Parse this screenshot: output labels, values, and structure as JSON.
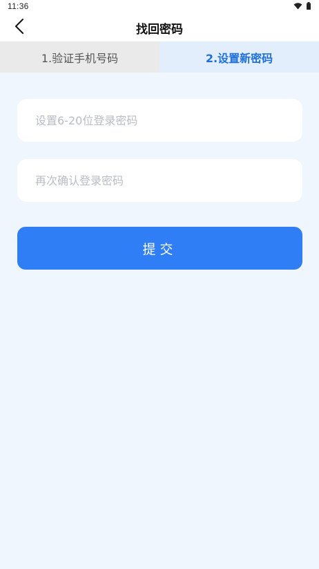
{
  "status_bar": {
    "time": "11:36",
    "icons": [
      "wifi-icon",
      "battery-icon"
    ]
  },
  "header": {
    "title": "找回密码",
    "back_icon": "chevron-left-icon"
  },
  "steps": [
    {
      "label": "1.验证手机号码",
      "active": false
    },
    {
      "label": "2.设置新密码",
      "active": true
    }
  ],
  "form": {
    "password_placeholder": "设置6-20位登录密码",
    "confirm_placeholder": "再次确认登录密码",
    "password_value": "",
    "confirm_value": ""
  },
  "submit": {
    "label": "提交"
  },
  "colors": {
    "page_bg": "#f0f6fd",
    "accent": "#2f7ef6",
    "active_step_text": "#1e6fd9",
    "active_step_bg": "#e3eefc",
    "inactive_step_bg": "#eaeaea"
  }
}
